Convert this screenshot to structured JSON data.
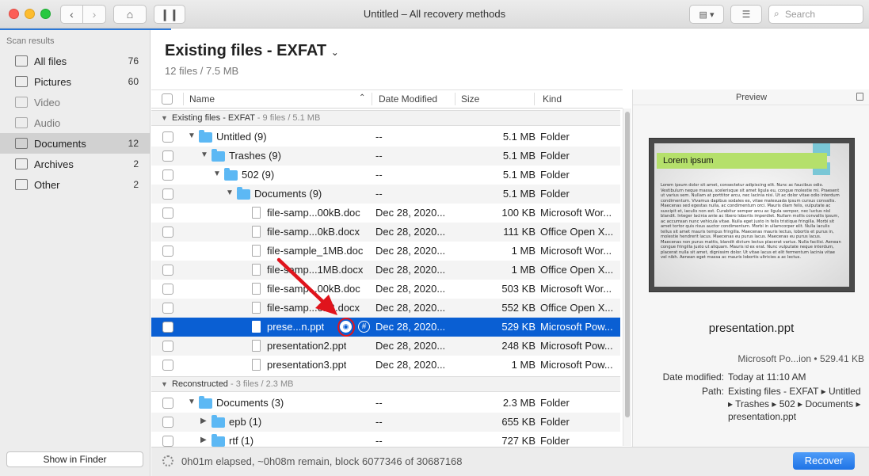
{
  "window": {
    "title": "Untitled – All recovery methods",
    "search_placeholder": "Search"
  },
  "sidebar": {
    "header": "Scan results",
    "items": [
      {
        "label": "All files",
        "count": "76",
        "icon": "all-files-icon"
      },
      {
        "label": "Pictures",
        "count": "60",
        "icon": "pictures-icon"
      },
      {
        "label": "Video",
        "count": "",
        "icon": "video-icon"
      },
      {
        "label": "Audio",
        "count": "",
        "icon": "audio-icon"
      },
      {
        "label": "Documents",
        "count": "12",
        "icon": "documents-icon",
        "active": true
      },
      {
        "label": "Archives",
        "count": "2",
        "icon": "archives-icon"
      },
      {
        "label": "Other",
        "count": "2",
        "icon": "other-icon"
      }
    ],
    "show_in_finder": "Show in Finder"
  },
  "main": {
    "title": "Existing files - EXFAT",
    "subtitle": "12 files / 7.5 MB"
  },
  "table": {
    "columns": {
      "name": "Name",
      "date": "Date Modified",
      "size": "Size",
      "kind": "Kind"
    },
    "groups": [
      {
        "label": "Existing files - EXFAT",
        "sub": " - 9 files / 5.1 MB"
      },
      {
        "label": "Reconstructed",
        "sub": " - 3 files / 2.3 MB"
      }
    ],
    "rows": [
      {
        "name": "Untitled (9)",
        "date": "--",
        "size": "5.1 MB",
        "kind": "Folder"
      },
      {
        "name": "Trashes (9)",
        "date": "--",
        "size": "5.1 MB",
        "kind": "Folder"
      },
      {
        "name": "502 (9)",
        "date": "--",
        "size": "5.1 MB",
        "kind": "Folder"
      },
      {
        "name": "Documents (9)",
        "date": "--",
        "size": "5.1 MB",
        "kind": "Folder"
      },
      {
        "name": "file-samp...00kB.doc",
        "date": "Dec 28, 2020...",
        "size": "100 KB",
        "kind": "Microsoft Wor..."
      },
      {
        "name": "file-samp...0kB.docx",
        "date": "Dec 28, 2020...",
        "size": "111 KB",
        "kind": "Office Open X..."
      },
      {
        "name": "file-sample_1MB.doc",
        "date": "Dec 28, 2020...",
        "size": "1 MB",
        "kind": "Microsoft Wor..."
      },
      {
        "name": "file-samp...1MB.docx",
        "date": "Dec 28, 2020...",
        "size": "1 MB",
        "kind": "Office Open X..."
      },
      {
        "name": "file-samp...00kB.doc",
        "date": "Dec 28, 2020...",
        "size": "503 KB",
        "kind": "Microsoft Wor..."
      },
      {
        "name": "file-samp...0kB.docx",
        "date": "Dec 28, 2020...",
        "size": "552 KB",
        "kind": "Office Open X..."
      },
      {
        "name": "prese...n.ppt",
        "date": "Dec 28, 2020...",
        "size": "529 KB",
        "kind": "Microsoft Pow..."
      },
      {
        "name": "presentation2.ppt",
        "date": "Dec 28, 2020...",
        "size": "248 KB",
        "kind": "Microsoft Pow..."
      },
      {
        "name": "presentation3.ppt",
        "date": "Dec 28, 2020...",
        "size": "1 MB",
        "kind": "Microsoft Pow..."
      },
      {
        "name": "Documents (3)",
        "date": "--",
        "size": "2.3 MB",
        "kind": "Folder"
      },
      {
        "name": "epb (1)",
        "date": "--",
        "size": "655 KB",
        "kind": "Folder"
      },
      {
        "name": "rtf (1)",
        "date": "--",
        "size": "727 KB",
        "kind": "Folder"
      }
    ]
  },
  "preview": {
    "header": "Preview",
    "thumb_title": "Lorem ipsum",
    "thumb_text": "Lorem ipsum dolor sit amet, consectetur adipiscing elit. Nunc ac faucibus odio. Vestibulum neque massa, scelerisque sit amet ligula eu, congue molestie mi. Praesent ut varius sem. Nullam at porttitor arcu, nec lacinia nisi. Ut ac dolor vitae odio interdum condimentum. Vivamus dapibus sodales ex, vitae malesuada ipsum cursus convallis. Maecenas sed egestas nulla, ac condimentum orci. Mauris diam felis, vulputate ac suscipit et, iaculis non est. Curabitur semper arcu ac ligula semper, nec luctus nisl blandit. Integer lacinia ante ac libero lobortis imperdiet. Nullam mollis convallis ipsum, ac accumsan nunc vehicula vitae. Nulla eget justo in felis tristique fringilla. Morbi sit amet tortor quis risus auctor condimentum. Morbi in ullamcorper elit. Nulla iaculis tellus sit amet mauris tempus fringilla. Maecenas mauris lectus, lobortis et purus in, molestie hendrerit lacus. Maecenas eu purus lacus. Maecenas eu purus lacus. Maecenas non purus mattis, blandit dictum lectus placerat varius. Nulla facilisi. Aenean congue fringilla justo ut aliquam. Mauris id ex erat. Nunc vulputate neque interdum, placerat nulla sit amet, dignissim dolor. Ut vitae lacus et elit fermentum lacinia vitae vel nibh. Aenean eget massa ac mauris lobortis ultricies a ac lectus.",
    "file_name": "presentation.ppt",
    "kind": "Microsoft Po...ion",
    "size": "529.41 KB",
    "date_label": "Date modified:",
    "date_value": "Today at 11:10 AM",
    "path_label": "Path:",
    "path_value": "Existing files - EXFAT ▸ Untitled ▸ Trashes ▸ 502 ▸ Documents ▸ presentation.ppt"
  },
  "status": {
    "text": "0h01m elapsed, ~0h08m remain, block 6077346 of 30687168",
    "recover": "Recover",
    "scan_progress_pct": 20
  },
  "colors": {
    "accent": "#0a5fd3",
    "folder": "#5cb8f4",
    "annotation": "#e0141c"
  }
}
